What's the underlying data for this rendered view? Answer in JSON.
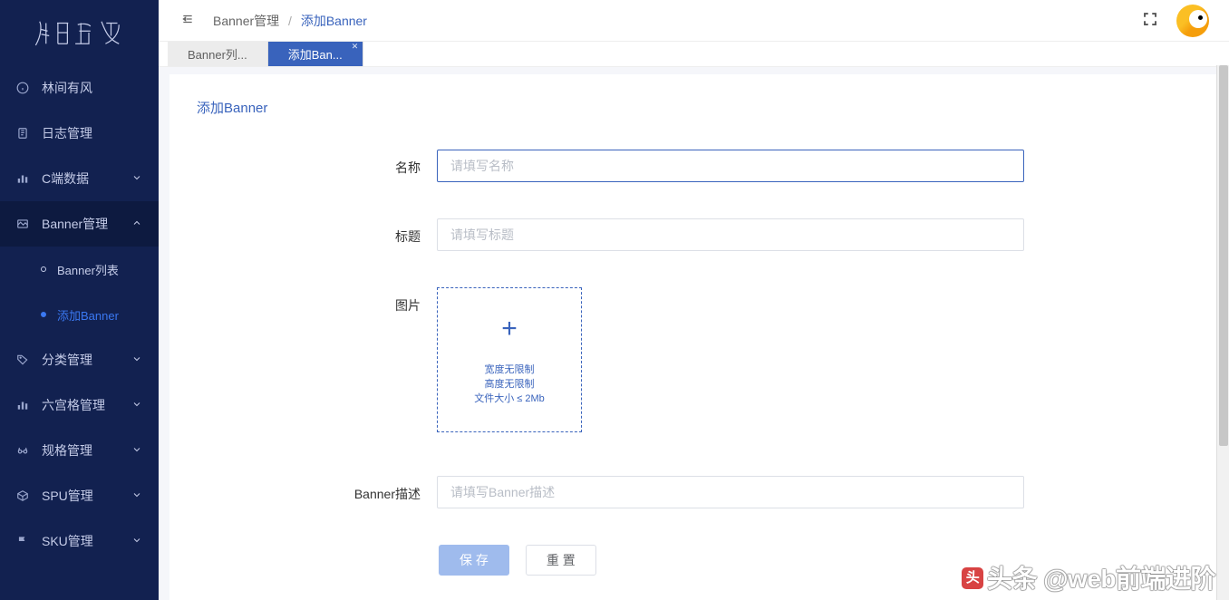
{
  "breadcrumb": {
    "parent": "Banner管理",
    "current": "添加Banner"
  },
  "tabs": {
    "list": "Banner列...",
    "add": "添加Ban..."
  },
  "menu": {
    "home": "林间有风",
    "log": "日志管理",
    "cdata": "C端数据",
    "banner": "Banner管理",
    "banner_list": "Banner列表",
    "banner_add": "添加Banner",
    "category": "分类管理",
    "grid": "六宫格管理",
    "spec": "规格管理",
    "spu": "SPU管理",
    "sku": "SKU管理"
  },
  "card": {
    "title": "添加Banner"
  },
  "form": {
    "name_label": "名称",
    "name_placeholder": "请填写名称",
    "title_label": "标题",
    "title_placeholder": "请填写标题",
    "image_label": "图片",
    "upload_hint1": "宽度无限制",
    "upload_hint2": "高度无限制",
    "upload_hint3": "文件大小 ≤ 2Mb",
    "desc_label": "Banner描述",
    "desc_placeholder": "请填写Banner描述",
    "save": "保 存",
    "reset": "重 置"
  },
  "watermark": "头条 @web前端进阶"
}
